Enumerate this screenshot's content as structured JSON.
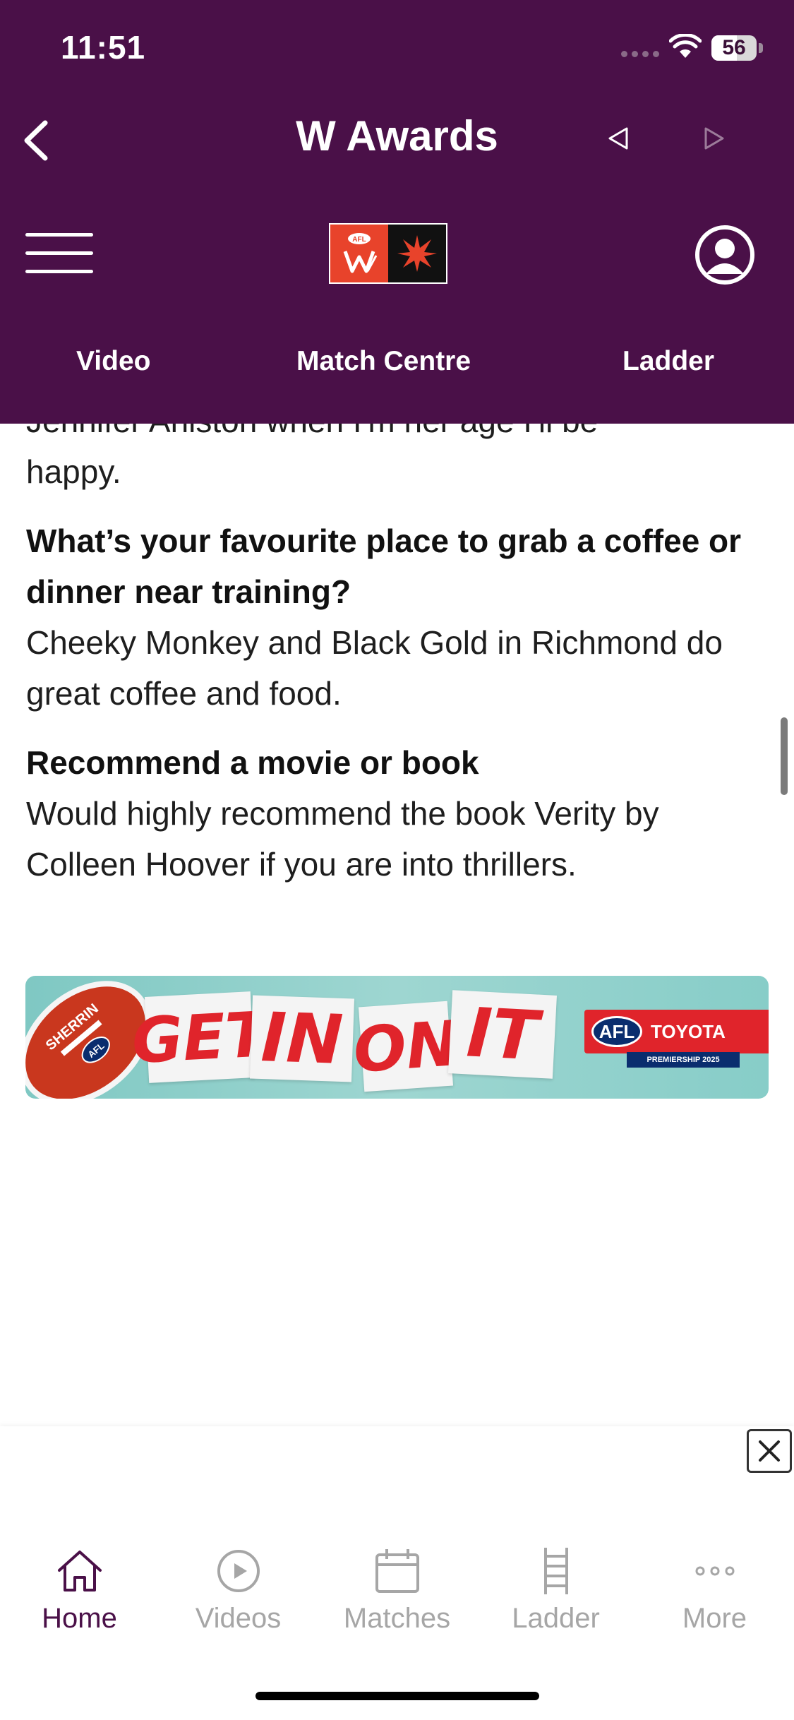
{
  "status_bar": {
    "time": "11:51",
    "battery": "56"
  },
  "header": {
    "title": "W Awards",
    "logo_label": "AFL"
  },
  "tabs": [
    {
      "label": "Video"
    },
    {
      "label": "Match Centre"
    },
    {
      "label": "Ladder"
    }
  ],
  "article": {
    "partial_line": "Jennifer Aniston when I'm her age I'll be",
    "intro_tail": "happy.",
    "qa": [
      {
        "question": "What’s your favourite place to grab a coffee or dinner near training?",
        "answer": "Cheeky Monkey and Black Gold in Richmond do great coffee and food."
      },
      {
        "question": "Recommend a movie or book",
        "answer": "Would highly recommend the book Verity by Colleen Hoover if you are into thrillers."
      }
    ]
  },
  "ad": {
    "ball_brand": "SHERRIN",
    "ball_logo": "AFL",
    "words": [
      "GET",
      "IN",
      "ON",
      "IT"
    ],
    "sponsor_afl": "AFL",
    "sponsor_name": "TOYOTA",
    "sponsor_sub": "PREMIERSHIP 2025"
  },
  "tabbar": [
    {
      "label": "Home",
      "icon": "home-icon",
      "active": true
    },
    {
      "label": "Videos",
      "icon": "play-circle-icon",
      "active": false
    },
    {
      "label": "Matches",
      "icon": "calendar-icon",
      "active": false
    },
    {
      "label": "Ladder",
      "icon": "ladder-icon",
      "active": false
    },
    {
      "label": "More",
      "icon": "more-dots-icon",
      "active": false
    }
  ],
  "colors": {
    "header_bg": "#4a1048",
    "accent": "#4a1048",
    "inactive": "#a6a6a6"
  }
}
